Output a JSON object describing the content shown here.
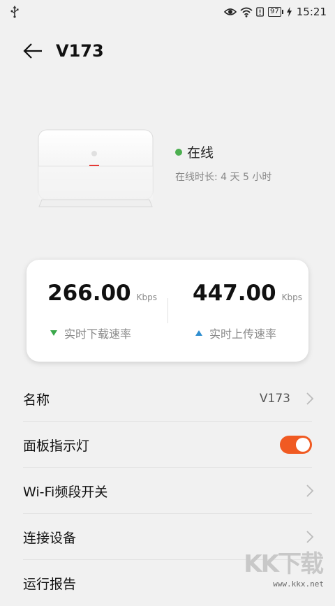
{
  "status_bar": {
    "battery": "97",
    "time": "15:21"
  },
  "header": {
    "title": "V173"
  },
  "device": {
    "status": "在线",
    "duration": "在线时长: 4 天 5 小时",
    "brand_color": "#e53935",
    "online_color": "#4caf50"
  },
  "speeds": {
    "download": {
      "value": "266.00",
      "unit": "Kbps",
      "label": "实时下载速率"
    },
    "upload": {
      "value": "447.00",
      "unit": "Kbps",
      "label": "实时上传速率"
    }
  },
  "list": {
    "name": {
      "label": "名称",
      "value": "V173"
    },
    "panel_light": {
      "label": "面板指示灯",
      "toggle_on": true,
      "accent": "#f05a22"
    },
    "wifi_band": {
      "label": "Wi-Fi频段开关"
    },
    "devices": {
      "label": "连接设备"
    },
    "report": {
      "label": "运行报告"
    }
  },
  "watermark": {
    "logo": "KK下载",
    "url": "www.kkx.net"
  }
}
